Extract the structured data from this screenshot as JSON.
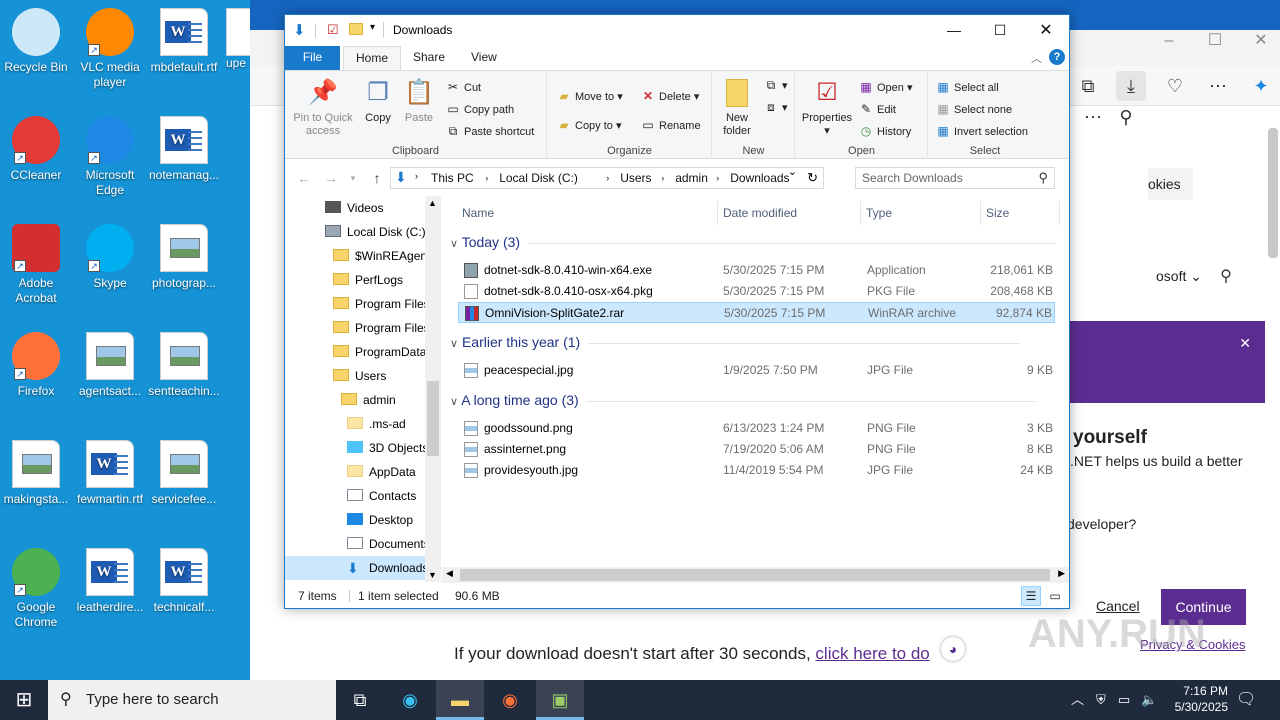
{
  "desktop": {
    "icons": [
      {
        "label": "Recycle Bin",
        "icon": "recycle-bin-icon"
      },
      {
        "label": "VLC media player",
        "icon": "vlc-icon"
      },
      {
        "label": "mbdefault.rtf",
        "icon": "word-doc-icon"
      },
      {
        "label": "CCleaner",
        "icon": "ccleaner-icon"
      },
      {
        "label": "Microsoft Edge",
        "icon": "edge-icon"
      },
      {
        "label": "notemanag...",
        "icon": "word-doc-icon"
      },
      {
        "label": "Adobe Acrobat",
        "icon": "acrobat-icon"
      },
      {
        "label": "Skype",
        "icon": "skype-icon"
      },
      {
        "label": "photograp...",
        "icon": "image-file-icon"
      },
      {
        "label": "Firefox",
        "icon": "firefox-icon"
      },
      {
        "label": "agentsact...",
        "icon": "image-file-icon"
      },
      {
        "label": "sentteachin...",
        "icon": "image-file-icon"
      },
      {
        "label": "makingsta...",
        "icon": "image-file-icon"
      },
      {
        "label": "fewmartin.rtf",
        "icon": "word-doc-icon"
      },
      {
        "label": "servicefee...",
        "icon": "image-file-icon"
      },
      {
        "label": "Google Chrome",
        "icon": "chrome-icon"
      },
      {
        "label": "leatherdire...",
        "icon": "word-doc-icon"
      },
      {
        "label": "technicalf...",
        "icon": "word-doc-icon"
      }
    ],
    "partial_label": "upe"
  },
  "browser": {
    "promo_heading": "yourself",
    "promo_text": ".NET helps us build a better",
    "promo_question": "developer?",
    "cancel_label": "Cancel",
    "continue_label": "Continue",
    "privacy_label": "Privacy & Cookies",
    "cookies_fragment": "okies",
    "microsoft_fragment": "osoft",
    "download_msg": "If your download doesn't start after 30 seconds,",
    "download_link": "click here to do",
    "accent_color": "#5c2d91",
    "watermark": "ANY.RUN"
  },
  "explorer": {
    "title": "Downloads",
    "tabs": {
      "file": "File",
      "home": "Home",
      "share": "Share",
      "view": "View"
    },
    "ribbon": {
      "clipboard": {
        "label": "Clipboard",
        "pin": "Pin to Quick access",
        "copy": "Copy",
        "paste": "Paste",
        "cut": "Cut",
        "copy_path": "Copy path",
        "paste_shortcut": "Paste shortcut"
      },
      "organize": {
        "label": "Organize",
        "move_to": "Move to",
        "copy_to": "Copy to",
        "delete": "Delete",
        "rename": "Rename"
      },
      "new": {
        "label": "New",
        "new_folder": "New folder"
      },
      "open": {
        "label": "Open",
        "properties": "Properties",
        "open": "Open",
        "edit": "Edit",
        "history": "History"
      },
      "select": {
        "label": "Select",
        "select_all": "Select all",
        "select_none": "Select none",
        "invert": "Invert selection"
      }
    },
    "address": {
      "crumbs": [
        "This PC",
        "Local Disk (C:)",
        "Users",
        "admin",
        "Downloads"
      ]
    },
    "search_placeholder": "Search Downloads",
    "nav": [
      {
        "label": "Videos",
        "type": "videos"
      },
      {
        "label": "Local Disk (C:)",
        "type": "drive"
      },
      {
        "label": "$WinREAgent",
        "type": "folder"
      },
      {
        "label": "PerfLogs",
        "type": "folder"
      },
      {
        "label": "Program Files",
        "type": "folder"
      },
      {
        "label": "Program Files",
        "type": "folder"
      },
      {
        "label": "ProgramData",
        "type": "folder"
      },
      {
        "label": "Users",
        "type": "folder"
      },
      {
        "label": "admin",
        "type": "folder"
      },
      {
        "label": ".ms-ad",
        "type": "folder"
      },
      {
        "label": "3D Objects",
        "type": "3d"
      },
      {
        "label": "AppData",
        "type": "folder"
      },
      {
        "label": "Contacts",
        "type": "contacts"
      },
      {
        "label": "Desktop",
        "type": "desktop"
      },
      {
        "label": "Documents",
        "type": "documents"
      },
      {
        "label": "Downloads",
        "type": "downloads"
      }
    ],
    "columns": {
      "name": "Name",
      "date": "Date modified",
      "type": "Type",
      "size": "Size"
    },
    "groups": [
      {
        "label": "Today (3)",
        "files": [
          {
            "name": "dotnet-sdk-8.0.410-win-x64.exe",
            "date": "5/30/2025 7:15 PM",
            "type": "Application",
            "size": "218,061 KB",
            "icon": "installer-icon",
            "selected": false
          },
          {
            "name": "dotnet-sdk-8.0.410-osx-x64.pkg",
            "date": "5/30/2025 7:15 PM",
            "type": "PKG File",
            "size": "208,468 KB",
            "icon": "blank-file-icon",
            "selected": false
          },
          {
            "name": "OmniVision-SplitGate2.rar",
            "date": "5/30/2025 7:15 PM",
            "type": "WinRAR archive",
            "size": "92,874 KB",
            "icon": "winrar-icon",
            "selected": true
          }
        ]
      },
      {
        "label": "Earlier this year (1)",
        "files": [
          {
            "name": "peacespecial.jpg",
            "date": "1/9/2025 7:50 PM",
            "type": "JPG File",
            "size": "9 KB",
            "icon": "image-file-icon",
            "selected": false
          }
        ]
      },
      {
        "label": "A long time ago (3)",
        "files": [
          {
            "name": "goodssound.png",
            "date": "6/13/2023 1:24 PM",
            "type": "PNG File",
            "size": "3 KB",
            "icon": "image-file-icon",
            "selected": false
          },
          {
            "name": "assinternet.png",
            "date": "7/19/2020 5:06 AM",
            "type": "PNG File",
            "size": "8 KB",
            "icon": "image-file-icon",
            "selected": false
          },
          {
            "name": "providesyouth.jpg",
            "date": "11/4/2019 5:54 PM",
            "type": "JPG File",
            "size": "24 KB",
            "icon": "image-file-icon",
            "selected": false
          }
        ]
      }
    ],
    "status": {
      "items": "7 items",
      "selected": "1 item selected",
      "size": "90.6 MB"
    }
  },
  "taskbar": {
    "search_placeholder": "Type here to search",
    "time": "7:16 PM",
    "date": "5/30/2025"
  }
}
